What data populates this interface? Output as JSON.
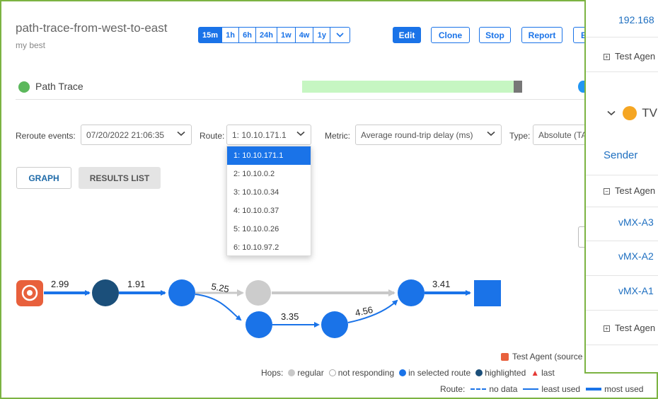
{
  "test": {
    "title": "path-trace-from-west-to-east",
    "subtitle": "my best"
  },
  "time_ranges": [
    "15m",
    "1h",
    "6h",
    "24h",
    "1w",
    "4w",
    "1y"
  ],
  "time_active": "15m",
  "actions": {
    "edit": "Edit",
    "clone": "Clone",
    "stop": "Stop",
    "report": "Report",
    "extra": "E"
  },
  "path_trace": {
    "label": "Path Trace"
  },
  "filters": {
    "reroute_label": "Reroute events:",
    "reroute_value": "07/20/2022 21:06:35",
    "route_label": "Route:",
    "route_value": "1: 10.10.171.1",
    "metric_label": "Metric:",
    "metric_value": "Average round-trip delay (ms)",
    "type_label": "Type:",
    "type_value": "Absolute (TA"
  },
  "view_tabs": {
    "graph": "GRAPH",
    "results": "RESULTS LIST"
  },
  "route_options": [
    "1: 10.10.171.1",
    "2: 10.10.0.2",
    "3: 10.10.0.34",
    "4: 10.10.0.37",
    "5: 10.10.0.26",
    "6: 10.10.97.2"
  ],
  "graph": {
    "edge_labels": [
      "2.99",
      "1.91",
      "5.25",
      "3.35",
      "4.56",
      "3.41"
    ]
  },
  "legend": {
    "agent": "Test Agent (source",
    "hops_label": "Hops:",
    "regular": "regular",
    "not_responding": "not responding",
    "in_selected_route": "in selected route",
    "highlighted": "highlighted",
    "last": "last",
    "route_label": "Route:",
    "no_data": "no data",
    "least_used": "least used",
    "most_used": "most used"
  },
  "colors": {
    "accent": "#1a73e8",
    "success": "#5cb85c",
    "dark_node": "#1b4f7a",
    "agent": "#e8603c",
    "border": "#7cb342"
  },
  "side_panel": {
    "ip": "192.168",
    "test_agent_1": "Test Agen",
    "section_label": "TV",
    "sender": "Sender",
    "test_agent_2": "Test Agen",
    "items": [
      "vMX-A3",
      "vMX-A2",
      "vMX-A1"
    ],
    "test_agent_3": "Test Agen"
  }
}
